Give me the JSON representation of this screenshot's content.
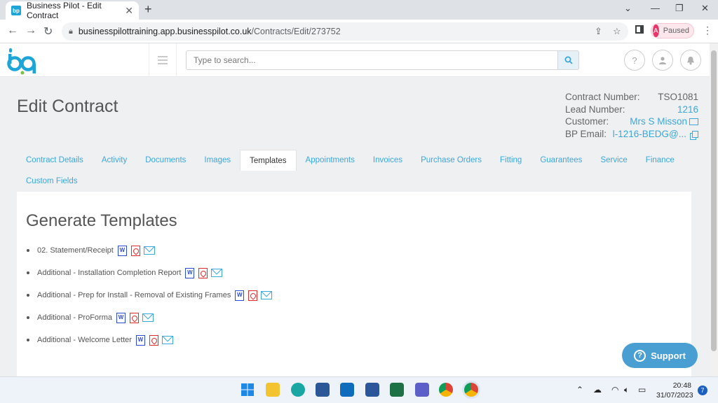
{
  "browser": {
    "tab_title": "Business Pilot - Edit Contract",
    "favicon_text": "bp",
    "url_host": "businesspilottraining.app.businesspilot.co.uk",
    "url_path": "/Contracts/Edit/273752",
    "profile_initial": "A",
    "profile_status": "Paused"
  },
  "header": {
    "search_placeholder": "Type to search...",
    "help_label": "?"
  },
  "page": {
    "title": "Edit Contract"
  },
  "contract_meta": {
    "contract_number_label": "Contract Number:",
    "contract_number": "TSO1081",
    "lead_number_label": "Lead Number:",
    "lead_number": "1216",
    "customer_label": "Customer:",
    "customer": "Mrs S Misson",
    "bp_email_label": "BP Email:",
    "bp_email": "l-1216-BEDG@..."
  },
  "tabs": {
    "row1": [
      {
        "label": "Contract Details"
      },
      {
        "label": "Activity"
      },
      {
        "label": "Documents"
      },
      {
        "label": "Images"
      },
      {
        "label": "Templates",
        "active": true
      },
      {
        "label": "Appointments"
      },
      {
        "label": "Invoices"
      },
      {
        "label": "Purchase Orders"
      },
      {
        "label": "Fitting"
      },
      {
        "label": "Guarantees"
      },
      {
        "label": "Service"
      },
      {
        "label": "Finance"
      }
    ],
    "row2": [
      {
        "label": "Custom Fields"
      }
    ]
  },
  "templates": {
    "heading": "Generate Templates",
    "word_icon_text": "W",
    "items": [
      {
        "name": "02. Statement/Receipt"
      },
      {
        "name": "Additional - Installation Completion Report"
      },
      {
        "name": "Additional - Prep for Install - Removal of Existing Frames"
      },
      {
        "name": "Additional - ProForma"
      },
      {
        "name": "Additional - Welcome Letter"
      }
    ]
  },
  "support": {
    "label": "Support",
    "icon_text": "?"
  },
  "taskbar": {
    "time": "20:48",
    "date": "31/07/2023",
    "notifications": "7"
  },
  "colors": {
    "accent": "#3ca7d9",
    "word": "#2b4bd6",
    "pdf": "#e02b2b",
    "support_bg": "#4a9fd2"
  }
}
